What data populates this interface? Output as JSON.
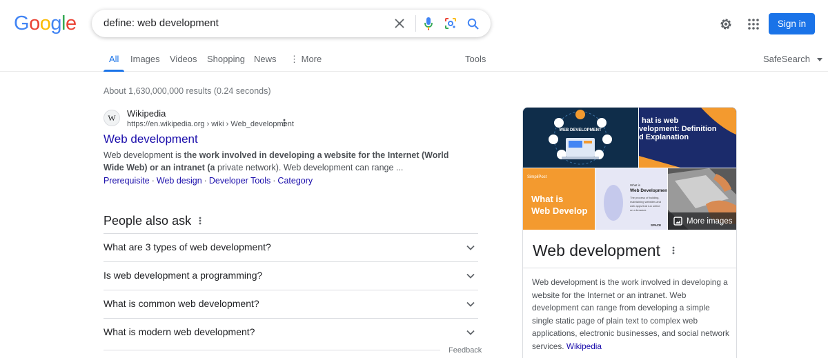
{
  "header": {
    "logo_letters": [
      "G",
      "o",
      "o",
      "g",
      "l",
      "e"
    ],
    "logo_colors": [
      "#4285f4",
      "#ea4335",
      "#fbbc05",
      "#4285f4",
      "#34a853",
      "#ea4335"
    ],
    "search_value": "define: web development",
    "signin_label": "Sign in"
  },
  "tabs": {
    "items": [
      "All",
      "Images",
      "Videos",
      "Shopping",
      "News",
      "⋮ More"
    ],
    "active": "All",
    "tools_label": "Tools",
    "safesearch_label": "SafeSearch"
  },
  "results": {
    "stats": "About 1,630,000,000 results (0.24 seconds)",
    "items": [
      {
        "favicon": "W",
        "site_name": "Wikipedia",
        "url": "https://en.wikipedia.org › wiki › Web_development",
        "title": "Web development",
        "snippet_pre": "Web development is ",
        "snippet_bold": "the work involved in developing a website for the Internet (World Wide Web) or an intranet (a",
        "snippet_post": " private network). Web development can range ...",
        "sitelinks": [
          "Prerequisite",
          "Web design",
          "Developer Tools",
          "Category"
        ]
      }
    ]
  },
  "people_also_ask": {
    "title": "People also ask",
    "questions": [
      "What are 3 types of web development?",
      "Is web development a programming?",
      "What is common web development?",
      "What is modern web development?"
    ],
    "feedback_label": "Feedback"
  },
  "knowledge_panel": {
    "title": "Web development",
    "more_images_label": "More images",
    "image_texts": {
      "img1": "WEB DEVELOPMENT",
      "img2": "hat is web velopment: Definition d Explanation",
      "img3_brand": "SimpliPost",
      "img3": "What is Web Develop",
      "img4_title": "What is Web Development?",
      "img4_body": "The process of building, and maintaining websites and web apps that run online on a browser.",
      "img4_brand": "SPACE"
    },
    "description": "Web development is the work involved in developing a website for the Internet or an intranet. Web development can range from developing a simple single static page of plain text to complex web applications, electronic businesses, and social network services.",
    "source_link": "Wikipedia"
  }
}
